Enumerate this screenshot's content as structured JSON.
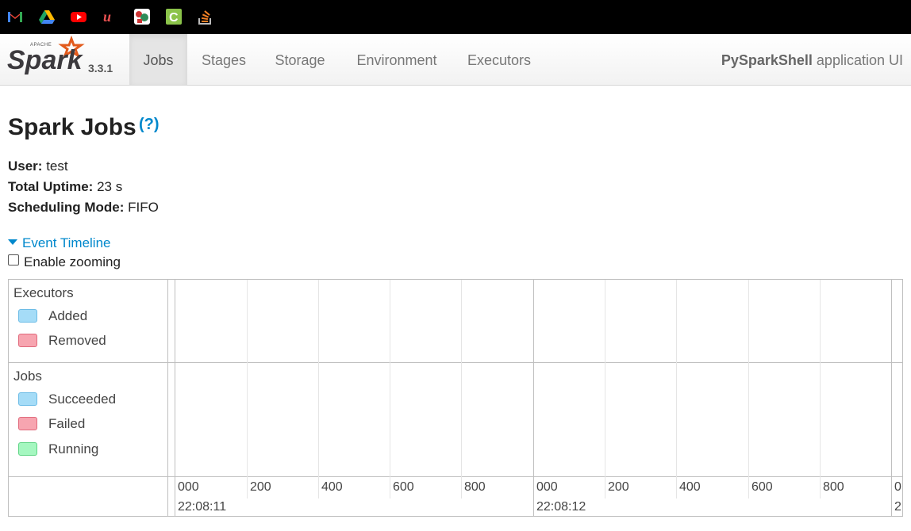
{
  "bookmarks": [
    {
      "name": "gmail-icon",
      "color": "#ea4335"
    },
    {
      "name": "google-drive-icon",
      "color": "#1fa463"
    },
    {
      "name": "youtube-icon",
      "color": "#ff0000"
    },
    {
      "name": "udemy-icon",
      "color": "#ec5252"
    },
    {
      "name": "coursera-like-icon",
      "color": "#cc3333"
    },
    {
      "name": "cyan-c-icon",
      "color": "#8bc34a"
    },
    {
      "name": "stackoverflow-icon",
      "color": "#f48024"
    }
  ],
  "brand": {
    "version": "3.3.1"
  },
  "nav": {
    "tabs": [
      {
        "label": "Jobs",
        "active": true
      },
      {
        "label": "Stages",
        "active": false
      },
      {
        "label": "Storage",
        "active": false
      },
      {
        "label": "Environment",
        "active": false
      },
      {
        "label": "Executors",
        "active": false
      }
    ],
    "app_name": "PySparkShell",
    "app_suffix": "application UI"
  },
  "page": {
    "title": "Spark Jobs",
    "help": "(?)",
    "user_label": "User:",
    "user_value": "test",
    "uptime_label": "Total Uptime:",
    "uptime_value": "23 s",
    "mode_label": "Scheduling Mode:",
    "mode_value": "FIFO"
  },
  "timeline": {
    "toggle_label": "Event Timeline",
    "zoom_label": "Enable zooming",
    "executors_title": "Executors",
    "executors_legend": [
      {
        "label": "Added",
        "color": "#a5dcf7",
        "border": "#6dbce6"
      },
      {
        "label": "Removed",
        "color": "#f7a5b0",
        "border": "#e06a7c"
      }
    ],
    "jobs_title": "Jobs",
    "jobs_legend": [
      {
        "label": "Succeeded",
        "color": "#a5dcf7",
        "border": "#6dbce6"
      },
      {
        "label": "Failed",
        "color": "#f7a5b0",
        "border": "#e06a7c"
      },
      {
        "label": "Running",
        "color": "#a5f7c0",
        "border": "#5fd485"
      }
    ],
    "minor_ticks": [
      "000",
      "200",
      "400",
      "600",
      "800",
      "000",
      "200",
      "400",
      "600",
      "800",
      "0"
    ],
    "major_ticks": [
      "22:08:11",
      "22:08:12",
      "2"
    ]
  }
}
